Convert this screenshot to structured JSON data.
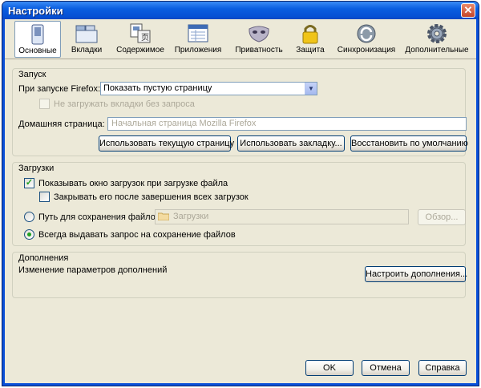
{
  "window": {
    "title": "Настройки",
    "close_symbol": "✕"
  },
  "toolbar": {
    "tabs": [
      {
        "label": "Основные",
        "icon": "switch-icon",
        "selected": true
      },
      {
        "label": "Вкладки",
        "icon": "tabs-icon",
        "selected": false
      },
      {
        "label": "Содержимое",
        "icon": "content-icon",
        "selected": false
      },
      {
        "label": "Приложения",
        "icon": "applications-icon",
        "selected": false
      },
      {
        "label": "Приватность",
        "icon": "mask-icon",
        "selected": false
      },
      {
        "label": "Защита",
        "icon": "lock-icon",
        "selected": false
      },
      {
        "label": "Синхронизация",
        "icon": "sync-icon",
        "selected": false
      },
      {
        "label": "Дополнительные",
        "icon": "gear-icon",
        "selected": false
      }
    ]
  },
  "startup": {
    "group_label": "Запуск",
    "on_start_label": "При запуске Firefox:",
    "on_start_value": "Показать пустую страницу",
    "no_load_tabs_label": "Не загружать вкладки без запроса",
    "no_load_tabs_checked": false,
    "homepage_label": "Домашняя страница:",
    "homepage_placeholder": "Начальная страница Mozilla Firefox",
    "use_current_label": "Использовать текущую страницу",
    "use_bookmark_label": "Использовать закладку...",
    "restore_default_label": "Восстановить по умолчанию"
  },
  "downloads": {
    "group_label": "Загрузки",
    "show_window_label": "Показывать окно загрузок при загрузке файла",
    "show_window_checked": true,
    "close_when_done_label": "Закрывать его после завершения всех загрузок",
    "close_when_done_checked": false,
    "save_path_label": "Путь для сохранения файлов",
    "save_path_value": "Загрузки",
    "browse_label": "Обзор...",
    "always_ask_label": "Всегда выдавать запрос на сохранение файлов",
    "selected_option": "always_ask"
  },
  "addons": {
    "group_label": "Дополнения",
    "description": "Изменение параметров дополнений",
    "manage_label": "Настроить дополнения..."
  },
  "footer": {
    "ok_label": "OK",
    "cancel_label": "Отмена",
    "help_label": "Справка"
  }
}
